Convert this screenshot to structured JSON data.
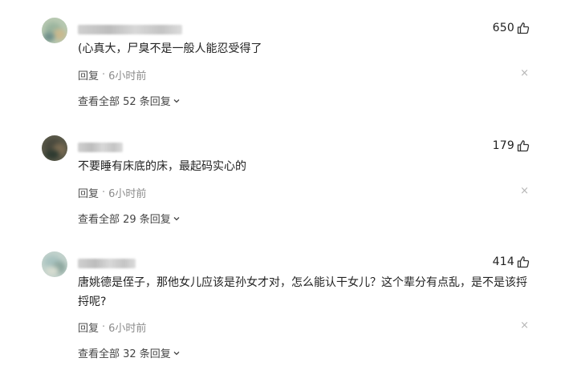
{
  "comments": [
    {
      "likes": "650",
      "content": "(心真大，尸臭不是一般人能忍受得了",
      "reply_label": "回复",
      "separator": "·",
      "time": "6小时前",
      "view_replies": "查看全部 52 条回复",
      "avatar_colors": [
        "#9bb59f",
        "#c9b98e",
        "#6f8f8a"
      ]
    },
    {
      "likes": "179",
      "content": "不要睡有床底的床，最起码实心的",
      "reply_label": "回复",
      "separator": "·",
      "time": "6小时前",
      "view_replies": "查看全部 29 条回复",
      "avatar_colors": [
        "#4a4a3e",
        "#7a6b52",
        "#2e3a30"
      ]
    },
    {
      "likes": "414",
      "content": "唐姚德是侄子，那他女儿应该是孙女才对，怎么能认干女儿？这个辈分有点乱，是不是该捋捋呢?",
      "reply_label": "回复",
      "separator": "·",
      "time": "6小时前",
      "view_replies": "查看全部 32 条回复",
      "avatar_colors": [
        "#a9c3c0",
        "#8fa8a0",
        "#d6dcd0"
      ]
    }
  ],
  "icons": {
    "like": "thumb-up-icon",
    "close": "close-icon",
    "expand": "chevron-down-icon",
    "close_glyph": "×"
  }
}
